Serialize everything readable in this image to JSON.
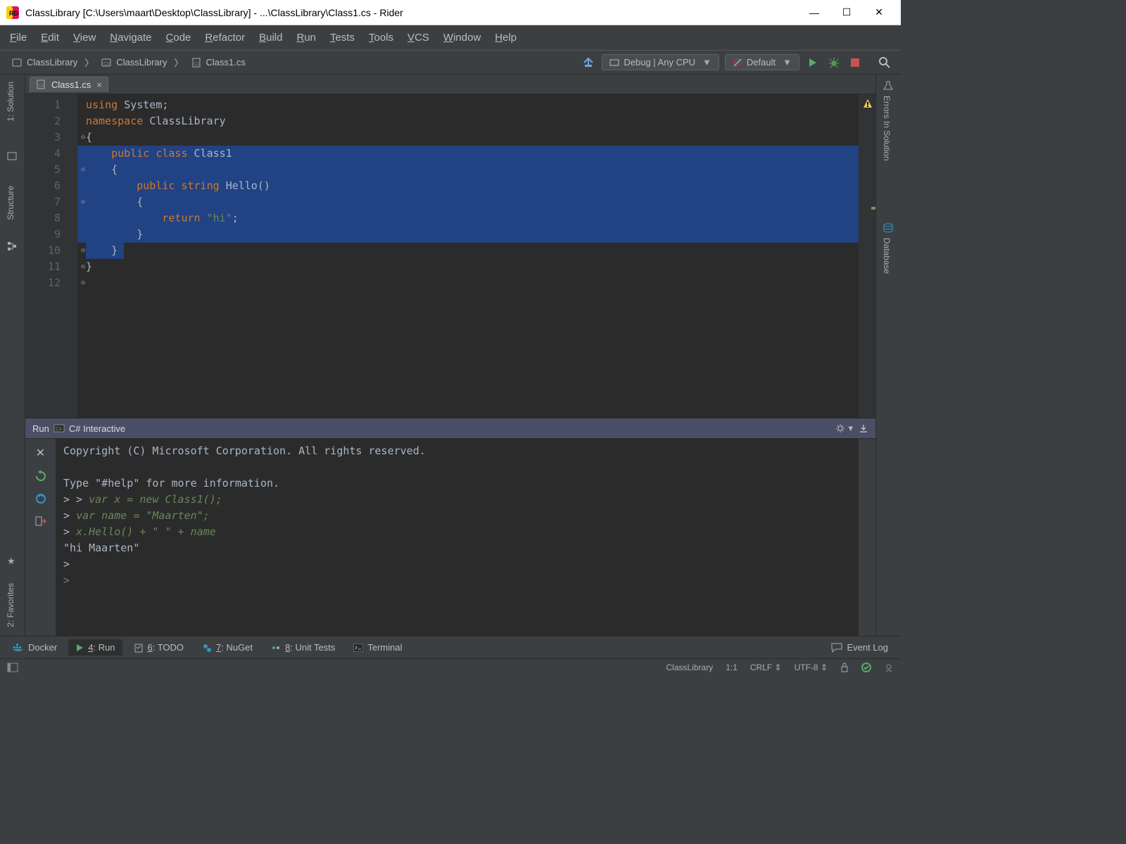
{
  "title": "ClassLibrary [C:\\Users\\maart\\Desktop\\ClassLibrary] - ...\\ClassLibrary\\Class1.cs - Rider",
  "menu": [
    "File",
    "Edit",
    "View",
    "Navigate",
    "Code",
    "Refactor",
    "Build",
    "Run",
    "Tests",
    "Tools",
    "VCS",
    "Window",
    "Help"
  ],
  "breadcrumbs": [
    "ClassLibrary",
    "ClassLibrary",
    "Class1.cs"
  ],
  "toolbar": {
    "config": "Debug | Any CPU",
    "runconfig": "Default"
  },
  "rails": {
    "left": [
      "1: Solution",
      "Structure"
    ],
    "right": [
      "Errors In Solution",
      "Database"
    ],
    "bottom_left": "2: Favorites"
  },
  "tab": {
    "name": "Class1.cs"
  },
  "code": {
    "lines": [
      {
        "n": 1,
        "html": "<span class='kw'>using</span> <span class='plain'>System;</span>"
      },
      {
        "n": 2,
        "html": ""
      },
      {
        "n": 3,
        "html": "<span class='kw'>namespace</span> <span class='plain'>ClassLibrary</span>"
      },
      {
        "n": 4,
        "html": "<span class='plain'>{</span>"
      },
      {
        "n": 5,
        "sel": true,
        "html": "    <span class='kw'>public</span> <span class='kw'>class</span> <span class='typ'>Class1</span>"
      },
      {
        "n": 6,
        "sel": true,
        "html": "    <span class='plain'>{</span>"
      },
      {
        "n": 7,
        "sel": true,
        "html": "        <span class='kw'>public</span> <span class='kw'>string</span> <span class='plain'>Hello()</span>"
      },
      {
        "n": 8,
        "sel": true,
        "html": "        <span class='plain'>{</span>"
      },
      {
        "n": 9,
        "sel": true,
        "html": "            <span class='kw'>return</span> <span class='str'>\"hi\"</span><span class='plain'>;</span>"
      },
      {
        "n": 10,
        "sel": true,
        "html": "        <span class='plain'>}</span>"
      },
      {
        "n": 11,
        "sel": true,
        "partial": true,
        "html": "    <span class='plain'>}</span>"
      },
      {
        "n": 12,
        "html": "<span class='plain'>}</span>"
      }
    ],
    "folds": [
      "",
      "",
      "⊖",
      "",
      "⊖",
      "",
      "⊖",
      "",
      "",
      "⊖",
      "⊖",
      "⊖"
    ]
  },
  "run": {
    "title": "Run",
    "panel": "C# Interactive",
    "lines": [
      {
        "t": "plain",
        "s": "Copyright (C) Microsoft Corporation. All rights reserved."
      },
      {
        "t": "plain",
        "s": ""
      },
      {
        "t": "plain",
        "s": "Type \"#help\" for more information."
      },
      {
        "t": "cmd",
        "s": "> > var x = new Class1();"
      },
      {
        "t": "cmd",
        "s": "> var name = \"Maarten\";"
      },
      {
        "t": "cmd",
        "s": "> x.Hello() + \" \" + name"
      },
      {
        "t": "res",
        "s": "\"hi Maarten\""
      },
      {
        "t": "plain",
        "s": ">"
      },
      {
        "t": "prompt",
        "s": ">"
      }
    ]
  },
  "toolstrip": [
    {
      "icon": "docker",
      "label": "Docker"
    },
    {
      "icon": "run",
      "label": "4: Run",
      "u": "4",
      "active": true
    },
    {
      "icon": "todo",
      "label": "6: TODO",
      "u": "6"
    },
    {
      "icon": "nuget",
      "label": "7: NuGet",
      "u": "7"
    },
    {
      "icon": "tests",
      "label": "8: Unit Tests",
      "u": "8"
    },
    {
      "icon": "terminal",
      "label": "Terminal"
    }
  ],
  "eventlog": "Event Log",
  "status": {
    "context": "ClassLibrary",
    "caret": "1:1",
    "eol": "CRLF",
    "enc": "UTF-8"
  }
}
